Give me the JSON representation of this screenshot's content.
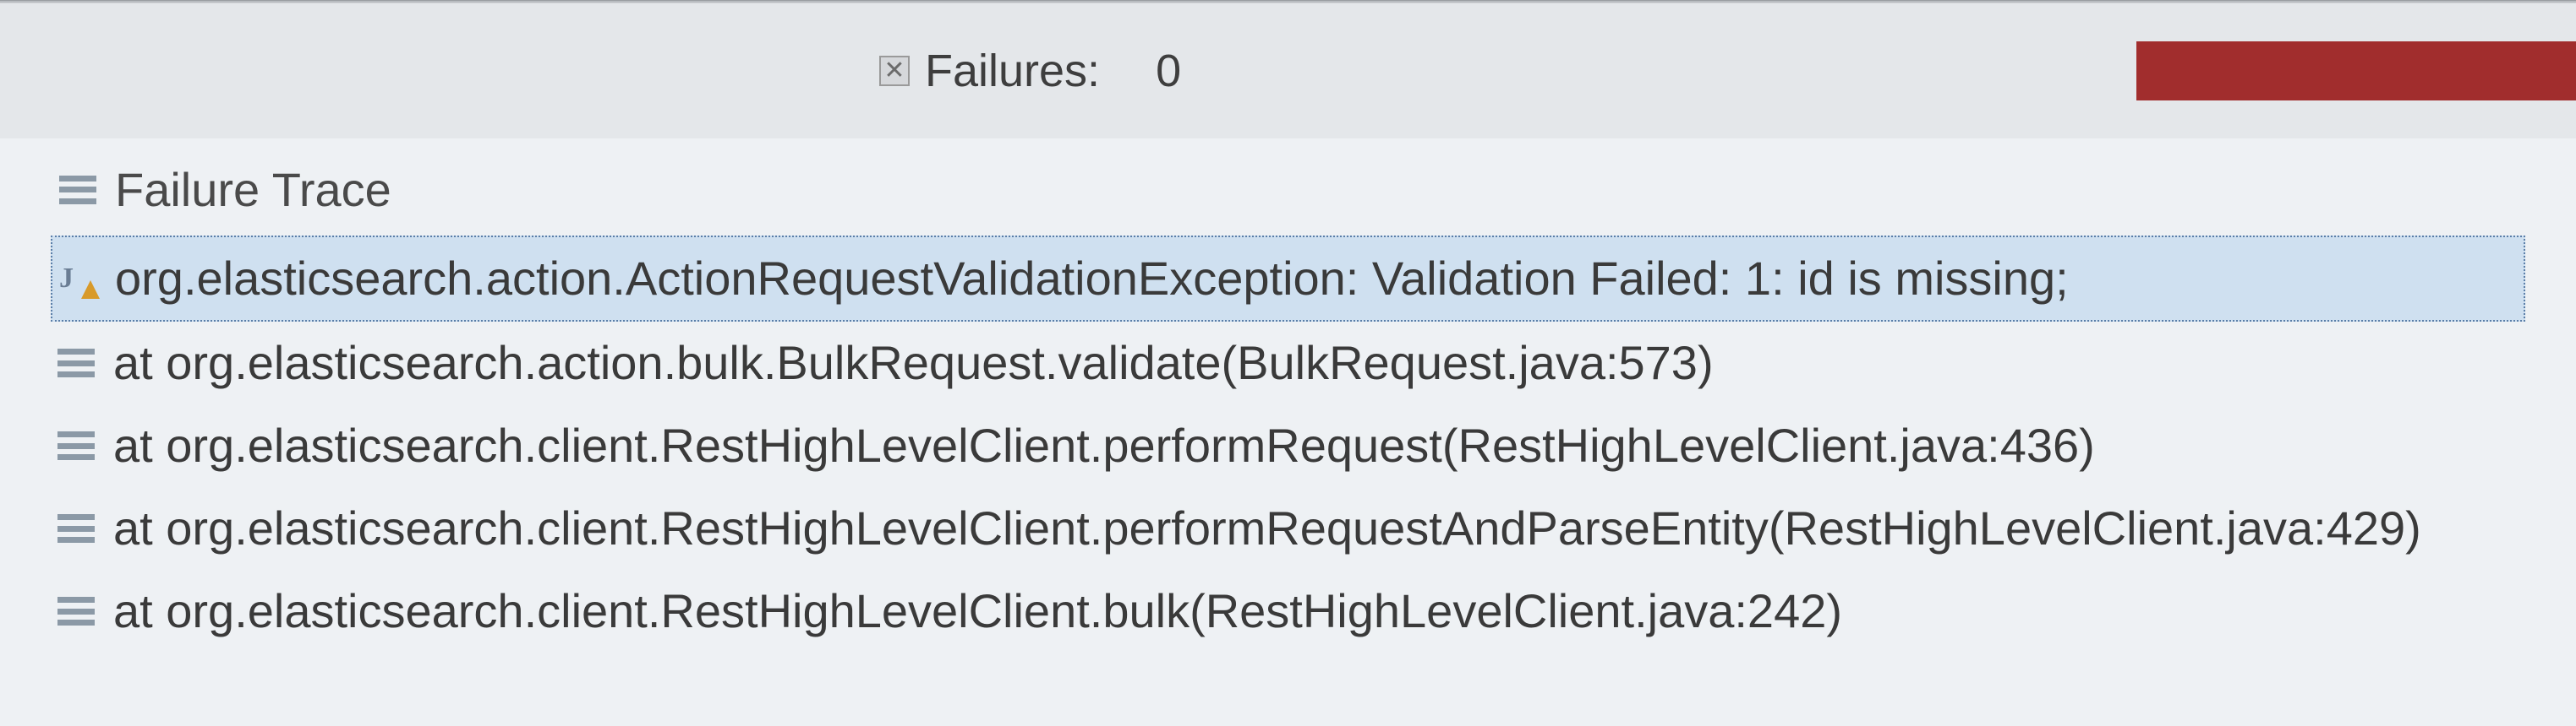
{
  "header": {
    "failures_label": "Failures:",
    "failures_count": "0"
  },
  "panel": {
    "title": "Failure Trace"
  },
  "trace": [
    {
      "icon": "j-exception",
      "selected": true,
      "text": "org.elasticsearch.action.ActionRequestValidationException: Validation Failed: 1: id is missing;"
    },
    {
      "icon": "stack",
      "selected": false,
      "text": "at org.elasticsearch.action.bulk.BulkRequest.validate(BulkRequest.java:573)"
    },
    {
      "icon": "stack",
      "selected": false,
      "text": "at org.elasticsearch.client.RestHighLevelClient.performRequest(RestHighLevelClient.java:436)"
    },
    {
      "icon": "stack",
      "selected": false,
      "text": "at org.elasticsearch.client.RestHighLevelClient.performRequestAndParseEntity(RestHighLevelClient.java:429)"
    },
    {
      "icon": "stack",
      "selected": false,
      "text": "at org.elasticsearch.client.RestHighLevelClient.bulk(RestHighLevelClient.java:242)"
    }
  ]
}
